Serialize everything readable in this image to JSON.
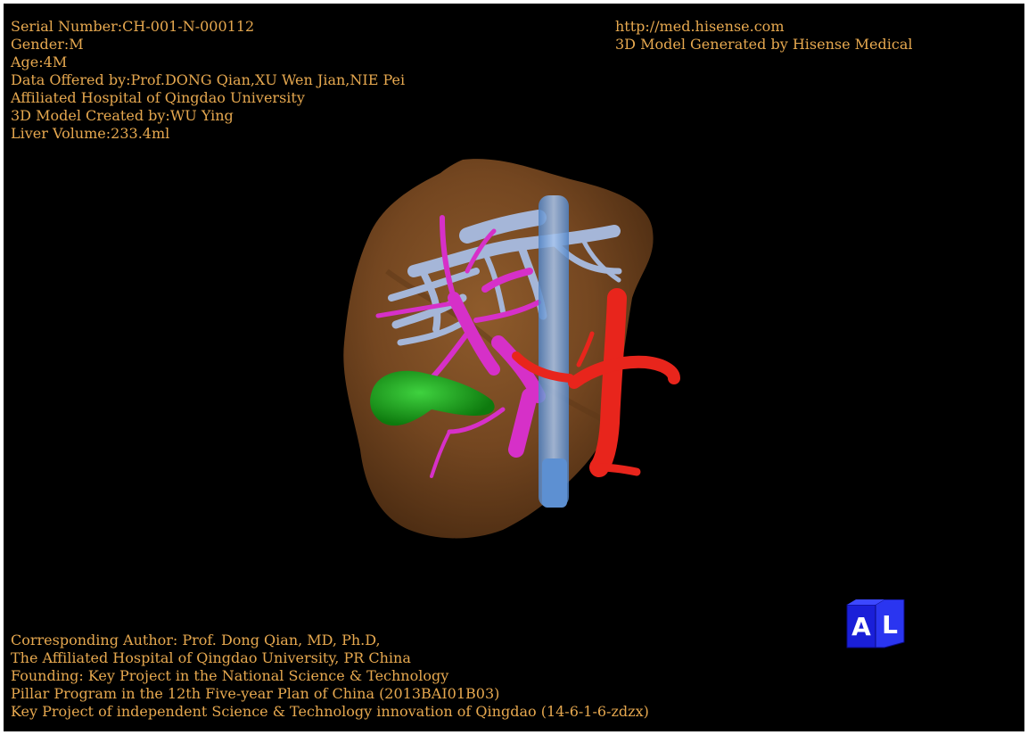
{
  "header_left": {
    "lines": [
      "Serial Number:CH-001-N-000112",
      "Gender:M",
      "Age:4M",
      "Data Offered by:Prof.DONG Qian,XU Wen Jian,NIE Pei",
      "Affiliated Hospital of Qingdao University",
      "3D Model Created by:WU Ying",
      "Liver Volume:233.4ml"
    ]
  },
  "header_right": {
    "lines": [
      "http://med.hisense.com",
      "3D Model Generated by Hisense Medical"
    ]
  },
  "footer": {
    "lines": [
      "Corresponding Author: Prof. Dong Qian, MD, Ph.D,",
      "The Affiliated Hospital of Qingdao University, PR China",
      "Founding: Key Project in the National Science & Technology",
      "Pillar Program in the 12th Five-year Plan of China (2013BAI01B03)",
      "Key Project of independent Science & Technology innovation of Qingdao (14-6-1-6-zdzx)"
    ]
  },
  "orientation_cube": {
    "front_label": "A",
    "side_label": "L"
  },
  "colors": {
    "text": "#e6a84f",
    "background": "#000000",
    "liver": "#7a4a22",
    "hepatic_vein": "#9fb2d6",
    "portal_vein": "#d62fc8",
    "gallbladder": "#1fa21f",
    "artery": "#e8251c",
    "ivc": "#6fa0d8",
    "cube": "#1a1fd8"
  }
}
